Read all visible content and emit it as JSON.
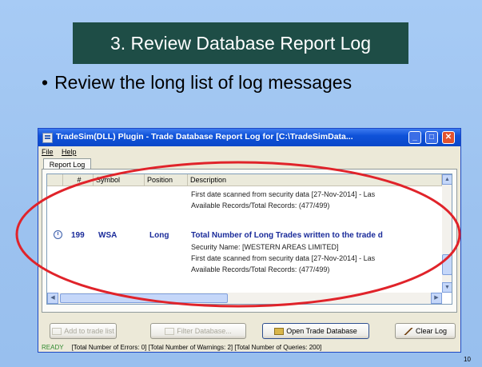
{
  "slide": {
    "title": "3. Review Database Report Log",
    "bullet": "Review the long list of log messages",
    "page_number": "10"
  },
  "window": {
    "title": "TradeSim(DLL) Plugin - Trade Database Report Log for [C:\\TradeSimData...",
    "menu": [
      "File",
      "Help"
    ],
    "tab_label": "Report Log",
    "columns": [
      "#",
      "Symbol",
      "Position",
      "Description"
    ],
    "rows": [
      {
        "number": "",
        "symbol": "",
        "position": "",
        "lines": [
          "First date scanned from security data [27-Nov-2014] - Las",
          "Available Records/Total Records: (477/499)"
        ]
      },
      {
        "number": "199",
        "symbol": "WSA",
        "position": "Long",
        "lines": [
          "Total Number of Long Trades written to the trade d",
          "Security Name: [WESTERN AREAS LIMITED]",
          "First date scanned from security data [27-Nov-2014] - Las",
          "Available Records/Total Records: (477/499)"
        ]
      }
    ],
    "buttons": {
      "left1": "Add to trade list",
      "left2": "Filter Database...",
      "open": "Open Trade Database",
      "clear": "Clear Log"
    },
    "status": {
      "ready": "READY",
      "text": "[Total Number of Errors: 0] [Total Number of Warnings: 2] [Total Number of Queries: 200]"
    }
  },
  "annotation_color": "#e0232a",
  "title_box_color": "#1e4d46"
}
